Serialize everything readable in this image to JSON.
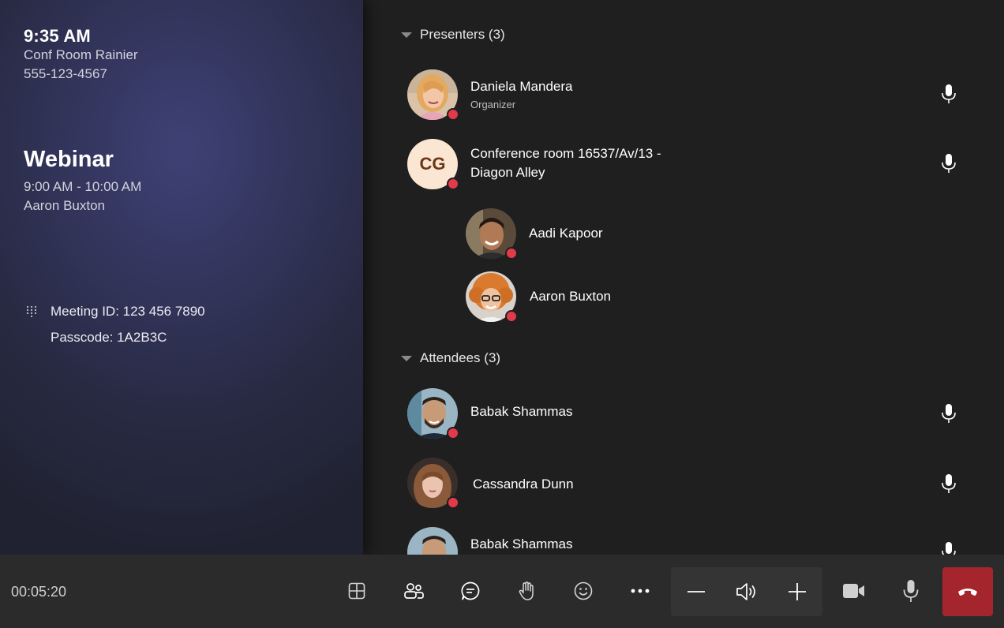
{
  "info": {
    "clock": "9:35 AM",
    "room": "Conf Room Rainier",
    "phone": "555-123-4567",
    "meeting_title": "Webinar",
    "meeting_time": "9:00 AM - 10:00 AM",
    "meeting_host": "Aaron Buxton",
    "meeting_id": "Meeting ID: 123 456 7890",
    "passcode": "Passcode: 1A2B3C"
  },
  "roster": {
    "presenters_header": "Presenters (3)",
    "attendees_header": "Attendees (3)",
    "presenters": [
      {
        "name": "Daniela Mandera",
        "role": "Organizer"
      },
      {
        "name": "Conference room 16537/Av/13 -",
        "name_line2": "Diagon Alley",
        "initials": "CG"
      },
      {
        "name": "Aadi Kapoor"
      },
      {
        "name": "Aaron Buxton"
      }
    ],
    "attendees": [
      {
        "name": "Babak Shammas"
      },
      {
        "name": "Cassandra Dunn"
      },
      {
        "name": "Babak Shammas"
      }
    ]
  },
  "controls": {
    "elapsed": "00:05:20",
    "buttons": [
      "layout-icon",
      "people-icon",
      "chat-icon",
      "raise-hand-icon",
      "reactions-icon",
      "more-icon",
      "volume-down-icon",
      "speaker-icon",
      "volume-up-icon",
      "camera-icon",
      "microphone-icon",
      "hang-up-icon"
    ]
  },
  "colors": {
    "background": "#1f1f1f",
    "control_bar": "#2b2b2b",
    "presence_busy": "#e33a4b",
    "hangup": "#a4262c",
    "initials_bg": "#fbe6d3",
    "initials_fg": "#6b3717"
  }
}
